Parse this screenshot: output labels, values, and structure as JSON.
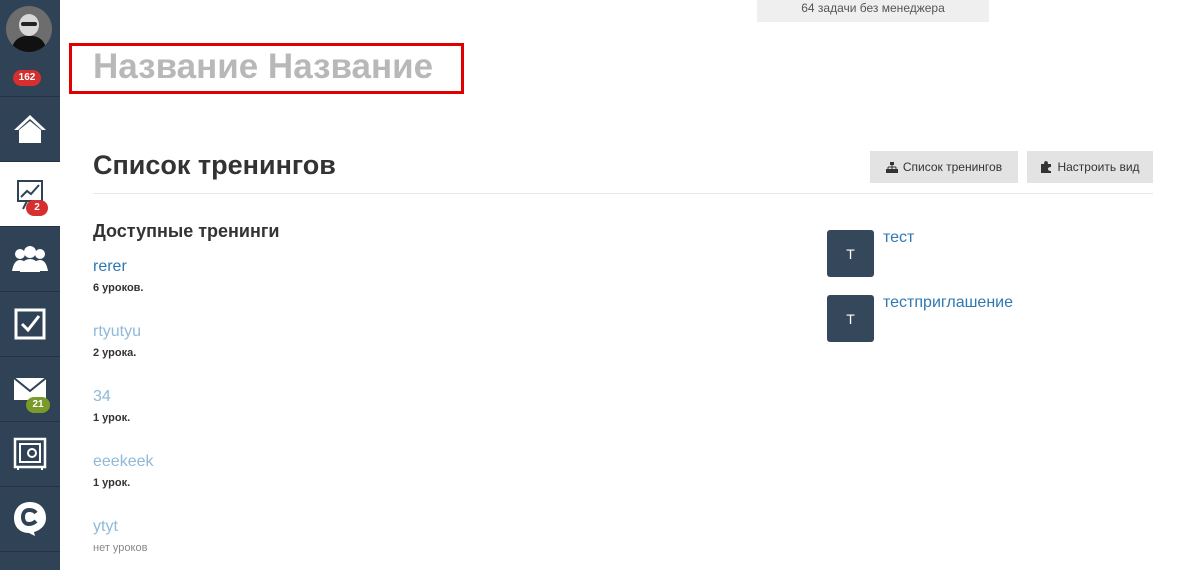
{
  "sidebar": {
    "avatar_badge": "162",
    "items": [
      {
        "name": "home-icon"
      },
      {
        "name": "trainings-chart-icon",
        "badge": "2",
        "badge_color": "#d62f2f",
        "active": true
      },
      {
        "name": "users-icon"
      },
      {
        "name": "tasks-checkbox-icon"
      },
      {
        "name": "mail-icon",
        "badge": "21",
        "badge_color": "#7a9a2a"
      },
      {
        "name": "safe-icon"
      },
      {
        "name": "chat-icon"
      }
    ]
  },
  "top_banner": "64 задачи без менеджера",
  "page_title": "Название Название",
  "section": {
    "title": "Список тренингов",
    "buttons": {
      "list_label": "Список тренингов",
      "view_label": "Настроить вид"
    }
  },
  "available": {
    "title": "Доступные тренинги",
    "trainings": [
      {
        "name": "rerer",
        "lessons": "6 уроков."
      },
      {
        "name": "rtyutyu",
        "lessons": "2 урока."
      },
      {
        "name": "34",
        "lessons": "1 урок."
      },
      {
        "name": "eeekeek",
        "lessons": "1 урок."
      },
      {
        "name": "ytyt",
        "lessons": "нет уроков"
      }
    ]
  },
  "invites": [
    {
      "initial": "Т",
      "name": "тест"
    },
    {
      "initial": "Т",
      "name": "тестприглашение"
    }
  ],
  "colors": {
    "sidebar": "#2f4256",
    "link": "#2f78b4",
    "link_light": "#8eb9d9",
    "highlight_box": "#e00000"
  }
}
